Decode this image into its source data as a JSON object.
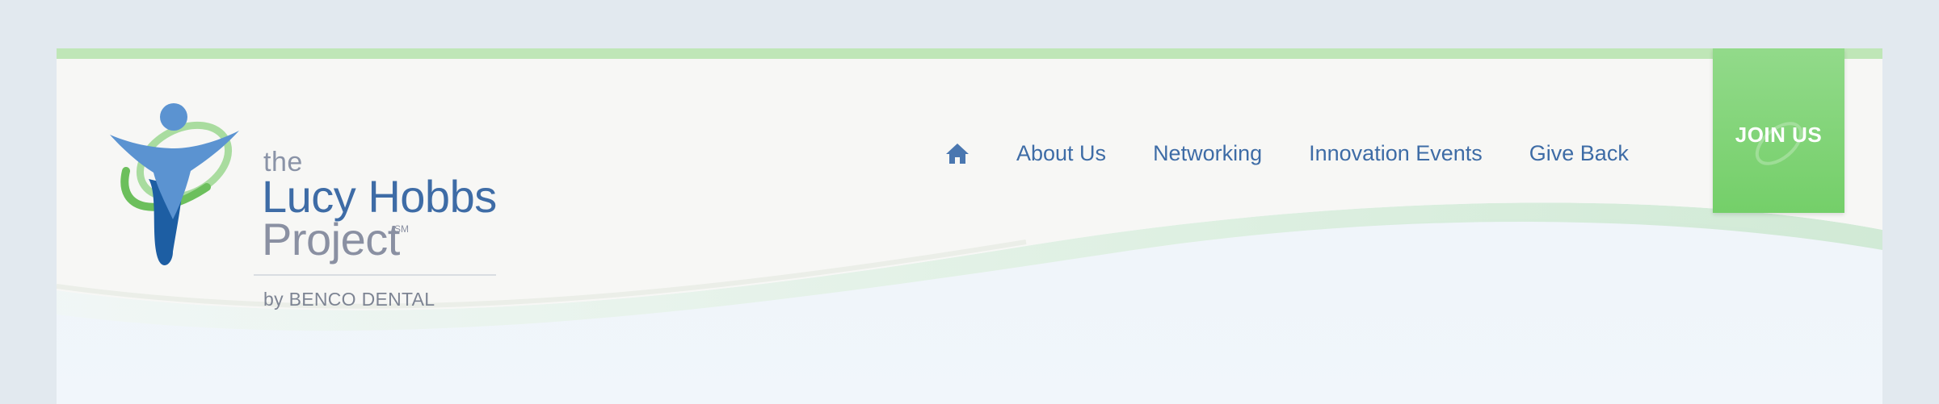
{
  "logo": {
    "the": "the",
    "name": "Lucy Hobbs",
    "project": "Project",
    "service_mark": "SM",
    "byline": "by BENCO DENTAL",
    "icon": "lucy-hobbs-figure-icon"
  },
  "nav": {
    "home_icon": "home-icon",
    "items": [
      {
        "label": "About Us"
      },
      {
        "label": "Networking"
      },
      {
        "label": "Innovation Events"
      },
      {
        "label": "Give Back"
      }
    ]
  },
  "cta": {
    "label": "JOIN US"
  },
  "colors": {
    "brand_blue": "#3e6ca6",
    "accent_green": "#7dd272",
    "top_bar": "#bfe6b7",
    "header_bg": "#f7f7f5",
    "page_bg": "#e2e9ef"
  }
}
